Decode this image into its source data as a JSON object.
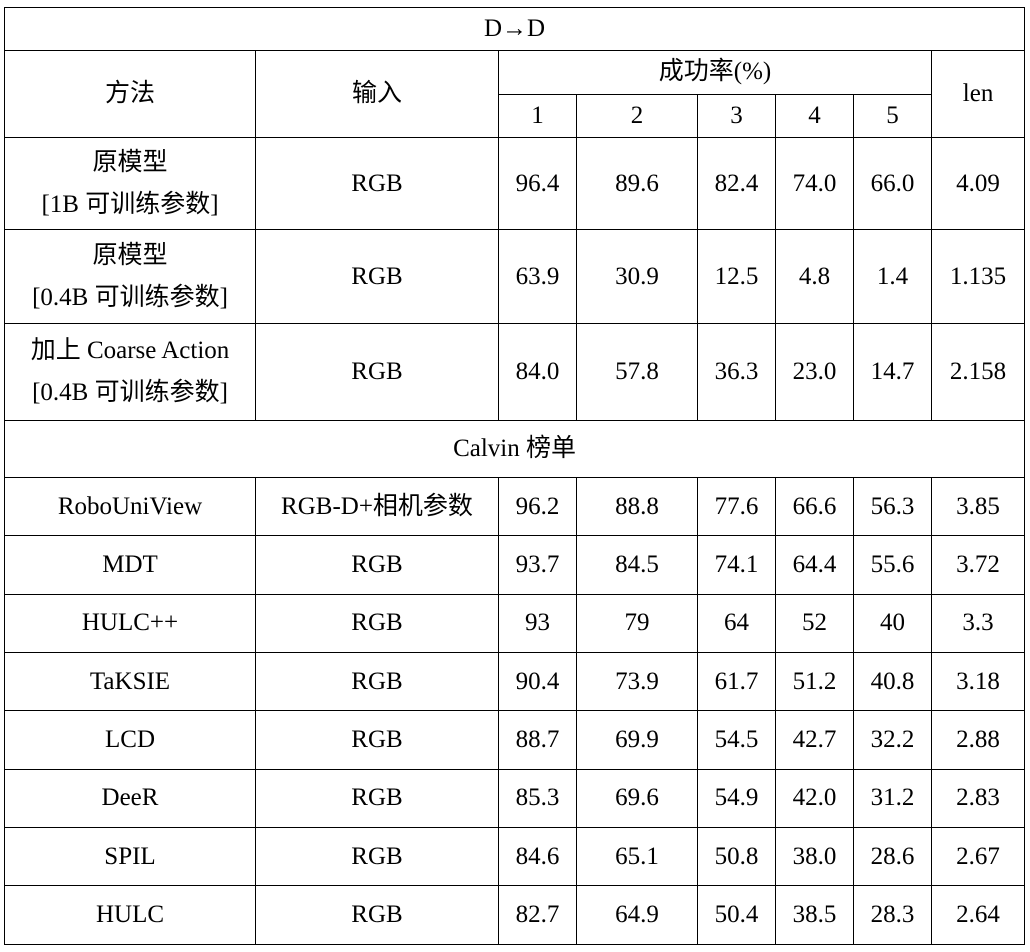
{
  "title": "D→D",
  "section_title": "Calvin 榜单",
  "header": {
    "method": "方法",
    "input": "输入",
    "success_rate": "成功率(%)",
    "len": "len",
    "steps": [
      "1",
      "2",
      "3",
      "4",
      "5"
    ]
  },
  "top_rows": [
    {
      "method_line1": "原模型",
      "method_line2": "[1B 可训练参数]",
      "input": "RGB",
      "values": [
        "96.4",
        "89.6",
        "82.4",
        "74.0",
        "66.0"
      ],
      "len": "4.09"
    },
    {
      "method_line1": "原模型",
      "method_line2": "[0.4B 可训练参数]",
      "input": "RGB",
      "values": [
        "63.9",
        "30.9",
        "12.5",
        "4.8",
        "1.4"
      ],
      "len": "1.135"
    },
    {
      "method_line1": "加上 Coarse Action",
      "method_line2": "[0.4B 可训练参数]",
      "input": "RGB",
      "values": [
        "84.0",
        "57.8",
        "36.3",
        "23.0",
        "14.7"
      ],
      "len": "2.158"
    }
  ],
  "leaderboard_rows": [
    {
      "method": "RoboUniView",
      "input": "RGB-D+相机参数",
      "values": [
        "96.2",
        "88.8",
        "77.6",
        "66.6",
        "56.3"
      ],
      "len": "3.85"
    },
    {
      "method": "MDT",
      "input": "RGB",
      "values": [
        "93.7",
        "84.5",
        "74.1",
        "64.4",
        "55.6"
      ],
      "len": "3.72"
    },
    {
      "method": "HULC++",
      "input": "RGB",
      "values": [
        "93",
        "79",
        "64",
        "52",
        "40"
      ],
      "len": "3.3"
    },
    {
      "method": "TaKSIE",
      "input": "RGB",
      "values": [
        "90.4",
        "73.9",
        "61.7",
        "51.2",
        "40.8"
      ],
      "len": "3.18"
    },
    {
      "method": "LCD",
      "input": "RGB",
      "values": [
        "88.7",
        "69.9",
        "54.5",
        "42.7",
        "32.2"
      ],
      "len": "2.88"
    },
    {
      "method": "DeeR",
      "input": "RGB",
      "values": [
        "85.3",
        "69.6",
        "54.9",
        "42.0",
        "31.2"
      ],
      "len": "2.83"
    },
    {
      "method": "SPIL",
      "input": "RGB",
      "values": [
        "84.6",
        "65.1",
        "50.8",
        "38.0",
        "28.6"
      ],
      "len": "2.67"
    },
    {
      "method": "HULC",
      "input": "RGB",
      "values": [
        "82.7",
        "64.9",
        "50.4",
        "38.5",
        "28.3"
      ],
      "len": "2.64"
    }
  ]
}
